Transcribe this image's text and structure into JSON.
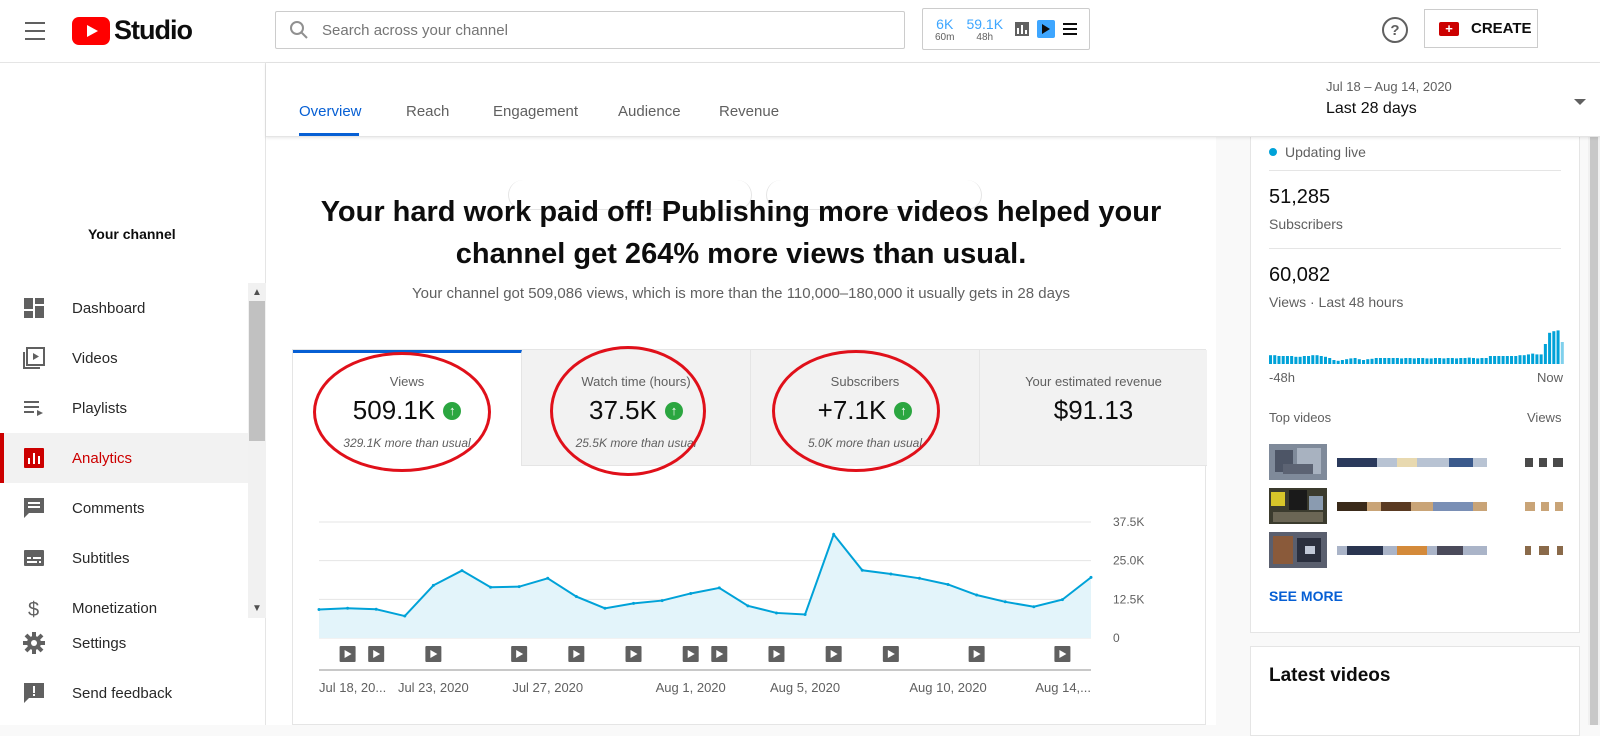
{
  "app": {
    "logo_text": "Studio"
  },
  "search": {
    "placeholder": "Search across your channel"
  },
  "realtime": {
    "stat1_value": "6K",
    "stat1_sub": "60m",
    "stat2_value": "59.1K",
    "stat2_sub": "48h"
  },
  "header": {
    "help_symbol": "?",
    "create_label": "CREATE"
  },
  "sidebar": {
    "channel_label": "Your channel",
    "items": [
      {
        "label": "Dashboard",
        "icon": "dashboard-icon"
      },
      {
        "label": "Videos",
        "icon": "videos-icon"
      },
      {
        "label": "Playlists",
        "icon": "playlists-icon"
      },
      {
        "label": "Analytics",
        "icon": "analytics-icon",
        "active": true
      },
      {
        "label": "Comments",
        "icon": "comments-icon"
      },
      {
        "label": "Subtitles",
        "icon": "subtitles-icon"
      },
      {
        "label": "Monetization",
        "icon": "monetization-icon"
      }
    ],
    "bottom": [
      {
        "label": "Settings",
        "icon": "gear-icon"
      },
      {
        "label": "Send feedback",
        "icon": "feedback-icon"
      }
    ]
  },
  "tabs": [
    {
      "label": "Overview",
      "active": true
    },
    {
      "label": "Reach"
    },
    {
      "label": "Engagement"
    },
    {
      "label": "Audience"
    },
    {
      "label": "Revenue"
    }
  ],
  "date_range": {
    "range": "Jul 18 – Aug 14, 2020",
    "label": "Last 28 days"
  },
  "main": {
    "headline": "Your hard work paid off! Publishing more videos helped your channel get 264% more views than usual.",
    "subline": "Your channel got 509,086 views, which is more than the 110,000–180,000 it usually gets in 28 days"
  },
  "metrics": [
    {
      "title": "Views",
      "value": "509.1K",
      "note": "329.1K more than usual",
      "up": true
    },
    {
      "title": "Watch time (hours)",
      "value": "37.5K",
      "note": "25.5K more than usual",
      "up": true
    },
    {
      "title": "Subscribers",
      "value": "+7.1K",
      "note": "5.0K more than usual",
      "up": true
    },
    {
      "title": "Your estimated revenue",
      "value": "$91.13",
      "note": "",
      "up": false
    }
  ],
  "colors": {
    "accent": "#065fd4",
    "brand": "#ff0000",
    "line": "#00a2d8",
    "area": "#e3f4fa",
    "annotation": "#e0101a",
    "up": "#2ba640"
  },
  "chart_data": {
    "type": "area",
    "series": [
      {
        "values": [
          9200,
          9600,
          9300,
          7100,
          17000,
          21800,
          16400,
          16600,
          19300,
          13400,
          9600,
          11200,
          12100,
          14400,
          16200,
          10400,
          8100,
          7600,
          33500,
          21900,
          20700,
          19300,
          17300,
          13900,
          11700,
          10100,
          12400,
          19600
        ]
      }
    ],
    "x_tick_labels": [
      "Jul 18, 20...",
      "Jul 23, 2020",
      "Jul 27, 2020",
      "Aug 1, 2020",
      "Aug 5, 2020",
      "Aug 10, 2020",
      "Aug 14,..."
    ],
    "y_tick_labels": [
      "37.5K",
      "25.0K",
      "12.5K",
      "0"
    ],
    "ylim": [
      0,
      37500
    ],
    "grid": true,
    "upload_markers_days": [
      1,
      2,
      4,
      7,
      9,
      11,
      13,
      14,
      16,
      18,
      20,
      23,
      26
    ]
  },
  "right_panel": {
    "live_label": "Updating live",
    "subscribers_value": "51,285",
    "subscribers_label": "Subscribers",
    "views_value": "60,082",
    "views_label": "Views · Last 48 hours",
    "mini_left": "-48h",
    "mini_right": "Now",
    "top_videos_label": "Top videos",
    "views_col_label": "Views",
    "see_more": "SEE MORE",
    "latest_videos": "Latest videos",
    "mini_bars": [
      0.22,
      0.22,
      0.2,
      0.2,
      0.2,
      0.2,
      0.18,
      0.18,
      0.2,
      0.2,
      0.22,
      0.22,
      0.2,
      0.18,
      0.15,
      0.1,
      0.08,
      0.1,
      0.12,
      0.14,
      0.15,
      0.12,
      0.1,
      0.12,
      0.13,
      0.15,
      0.15,
      0.15,
      0.15,
      0.15,
      0.15,
      0.14,
      0.15,
      0.15,
      0.14,
      0.15,
      0.15,
      0.14,
      0.14,
      0.15,
      0.15,
      0.14,
      0.15,
      0.15,
      0.14,
      0.15,
      0.15,
      0.16,
      0.15,
      0.14,
      0.15,
      0.15,
      0.2,
      0.2,
      0.2,
      0.2,
      0.2,
      0.2,
      0.2,
      0.22,
      0.22,
      0.24,
      0.26,
      0.24,
      0.24,
      0.5,
      0.78,
      0.82,
      0.84,
      0.55
    ]
  }
}
